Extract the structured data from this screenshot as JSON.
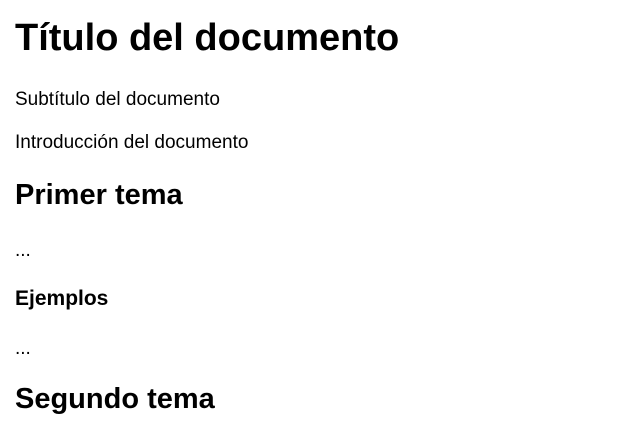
{
  "document": {
    "title": "Título del documento",
    "subtitle": "Subtítulo del documento",
    "introduction": "Introducción del documento",
    "sections": [
      {
        "heading": "Primer tema",
        "body": "...",
        "subsections": [
          {
            "heading": "Ejemplos",
            "body": "..."
          }
        ]
      },
      {
        "heading": "Segundo tema"
      }
    ]
  }
}
